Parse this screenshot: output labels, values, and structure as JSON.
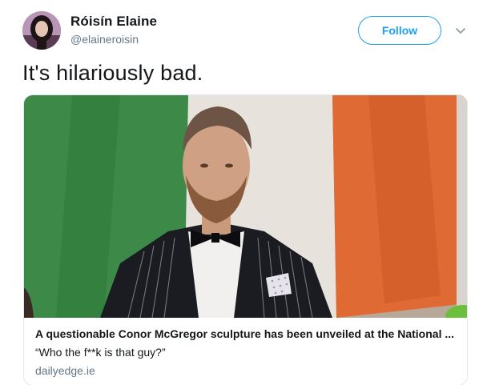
{
  "user": {
    "display_name": "Róisín Elaine",
    "handle": "@elaineroisin"
  },
  "actions": {
    "follow_label": "Follow",
    "menu_icon": "chevron-down-icon"
  },
  "tweet": {
    "text": "It's hilariously bad."
  },
  "card": {
    "title": "A questionable Conor McGregor sculpture has been unveiled at the National ...",
    "description": "“Who the f**k is that guy?”",
    "domain": "dailyedge.ie"
  },
  "colors": {
    "accent": "#1da1f2",
    "secondary_text": "#657786",
    "border": "#e1e8ed"
  }
}
